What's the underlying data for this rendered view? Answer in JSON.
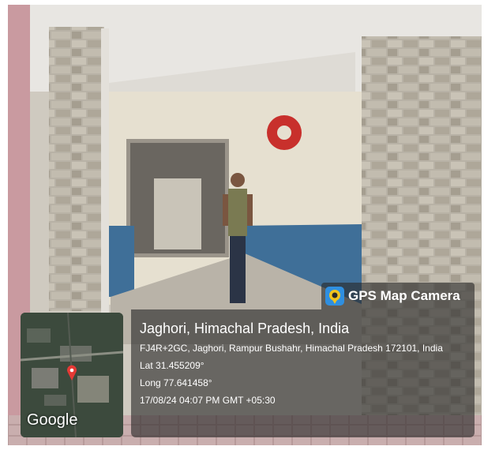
{
  "badge": {
    "label": "GPS Map Camera",
    "icon": "gps-map-camera-app-icon"
  },
  "minimap": {
    "logo_text": "Google",
    "marker_icon": "location-pin-icon"
  },
  "location": {
    "title": "Jaghori, Himachal Pradesh, India",
    "address": "FJ4R+2GC, Jaghori, Rampur Bushahr, Himachal Pradesh 172101, India",
    "latitude": "Lat 31.455209°",
    "longitude": "Long 77.641458°",
    "timestamp": "17/08/24 04:07 PM GMT +05:30"
  }
}
